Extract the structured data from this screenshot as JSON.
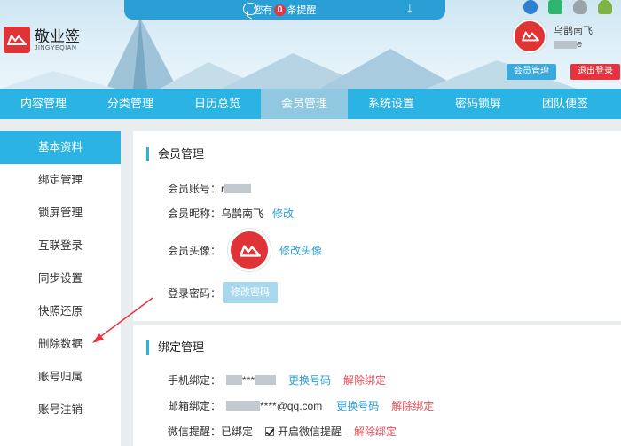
{
  "header": {
    "notice_prefix": "您有",
    "notice_count": "0",
    "notice_suffix": "条提醒",
    "logo_cn": "敬业签",
    "logo_en": "JINGYEQIAN",
    "username": "乌鹊南飞",
    "user_sub_suffix": "e",
    "member_button": "会员管理",
    "logout_button": "退出登录"
  },
  "nav": {
    "items": [
      "内容管理",
      "分类管理",
      "日历总览",
      "会员管理",
      "系统设置",
      "密码锁屏",
      "团队便签"
    ],
    "active_index": 3
  },
  "sidebar": {
    "items": [
      "基本资料",
      "绑定管理",
      "锁屏管理",
      "互联登录",
      "同步设置",
      "快照还原",
      "删除数据",
      "账号归属",
      "账号注销"
    ],
    "active_index": 0
  },
  "member": {
    "title": "会员管理",
    "account_label": "会员账号：",
    "account_value": "r",
    "nickname_label": "会员昵称：",
    "nickname_value": "乌鹊南飞",
    "nickname_edit": "修改",
    "avatar_label": "会员头像：",
    "avatar_edit": "修改头像",
    "password_label": "登录密码：",
    "password_button": "修改密码"
  },
  "binding": {
    "title": "绑定管理",
    "phone_label": "手机绑定：",
    "phone_value_mid": "***",
    "phone_change": "更换号码",
    "phone_unbind": "解除绑定",
    "email_label": "邮箱绑定：",
    "email_value_tail": "****@qq.com",
    "email_change": "更换号码",
    "email_unbind": "解除绑定",
    "wechat_label": "微信提醒：",
    "wechat_status": "已绑定",
    "wechat_option": "开启微信提醒",
    "wechat_option_checked": true,
    "wechat_unbind": "解除绑定"
  },
  "colors": {
    "primary": "#2ab3e3",
    "brand_red": "#e03336",
    "link_blue": "#2a9fd6",
    "link_red": "#e8505b"
  }
}
